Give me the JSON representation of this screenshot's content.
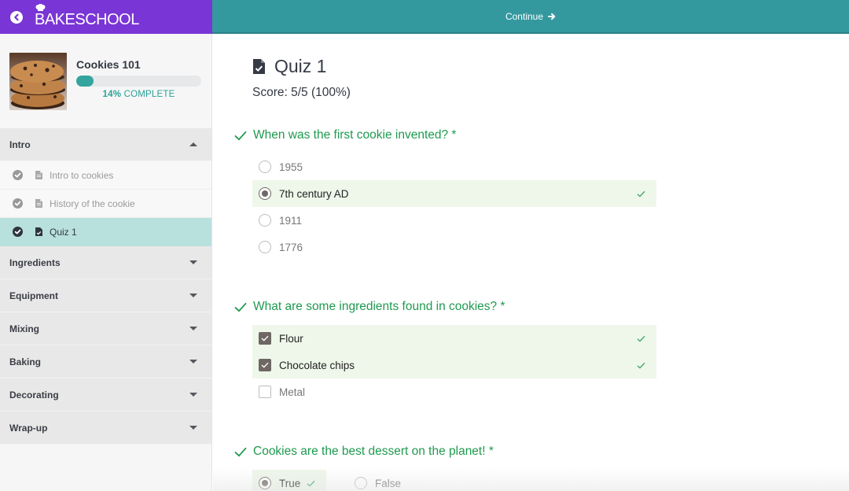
{
  "brand": {
    "name": "BAKESCHOOL",
    "color": "#7a35d6",
    "back_icon": "circle-chevron-left-icon",
    "logo_icon": "chef-hat-icon"
  },
  "topbar": {
    "color": "#33999f",
    "continue_label": "Continue",
    "continue_icon": "arrow-right-icon"
  },
  "course": {
    "title": "Cookies 101",
    "thumbnail": "stacked-cookies-image",
    "progress_percent": 14,
    "progress_text": "14%",
    "progress_suffix": "COMPLETE",
    "accent": "#33a59e"
  },
  "sidebar": {
    "sections": [
      {
        "label": "Intro",
        "expanded": true,
        "lessons": [
          {
            "label": "Intro to cookies",
            "icon": "document-icon",
            "completed": true,
            "active": false
          },
          {
            "label": "History of the cookie",
            "icon": "document-icon",
            "completed": true,
            "active": false
          },
          {
            "label": "Quiz 1",
            "icon": "quiz-document-icon",
            "completed": true,
            "active": true
          }
        ]
      },
      {
        "label": "Ingredients",
        "expanded": false
      },
      {
        "label": "Equipment",
        "expanded": false
      },
      {
        "label": "Mixing",
        "expanded": false
      },
      {
        "label": "Baking",
        "expanded": false
      },
      {
        "label": "Decorating",
        "expanded": false
      },
      {
        "label": "Wrap-up",
        "expanded": false
      }
    ]
  },
  "quiz": {
    "title": "Quiz 1",
    "icon": "quiz-document-icon",
    "score": "Score: 5/5 (100%)",
    "correct_color": "#1e9a4f",
    "questions": [
      {
        "text": "When was the first cookie invented? *",
        "type": "radio",
        "status": "correct",
        "options": [
          {
            "label": "1955",
            "selected": false,
            "correct": false
          },
          {
            "label": "7th century AD",
            "selected": true,
            "correct": true
          },
          {
            "label": "1911",
            "selected": false,
            "correct": false
          },
          {
            "label": "1776",
            "selected": false,
            "correct": false
          }
        ]
      },
      {
        "text": "What are some ingredients found in cookies? *",
        "type": "checkbox",
        "status": "correct",
        "options": [
          {
            "label": "Flour",
            "selected": true,
            "correct": true
          },
          {
            "label": "Chocolate chips",
            "selected": true,
            "correct": true
          },
          {
            "label": "Metal",
            "selected": false,
            "correct": false
          }
        ]
      },
      {
        "text": "Cookies are the best dessert on the planet! *",
        "type": "true-false",
        "status": "correct",
        "options": [
          {
            "label": "True",
            "selected": true,
            "correct": true
          },
          {
            "label": "False",
            "selected": false,
            "correct": false
          }
        ]
      }
    ]
  }
}
